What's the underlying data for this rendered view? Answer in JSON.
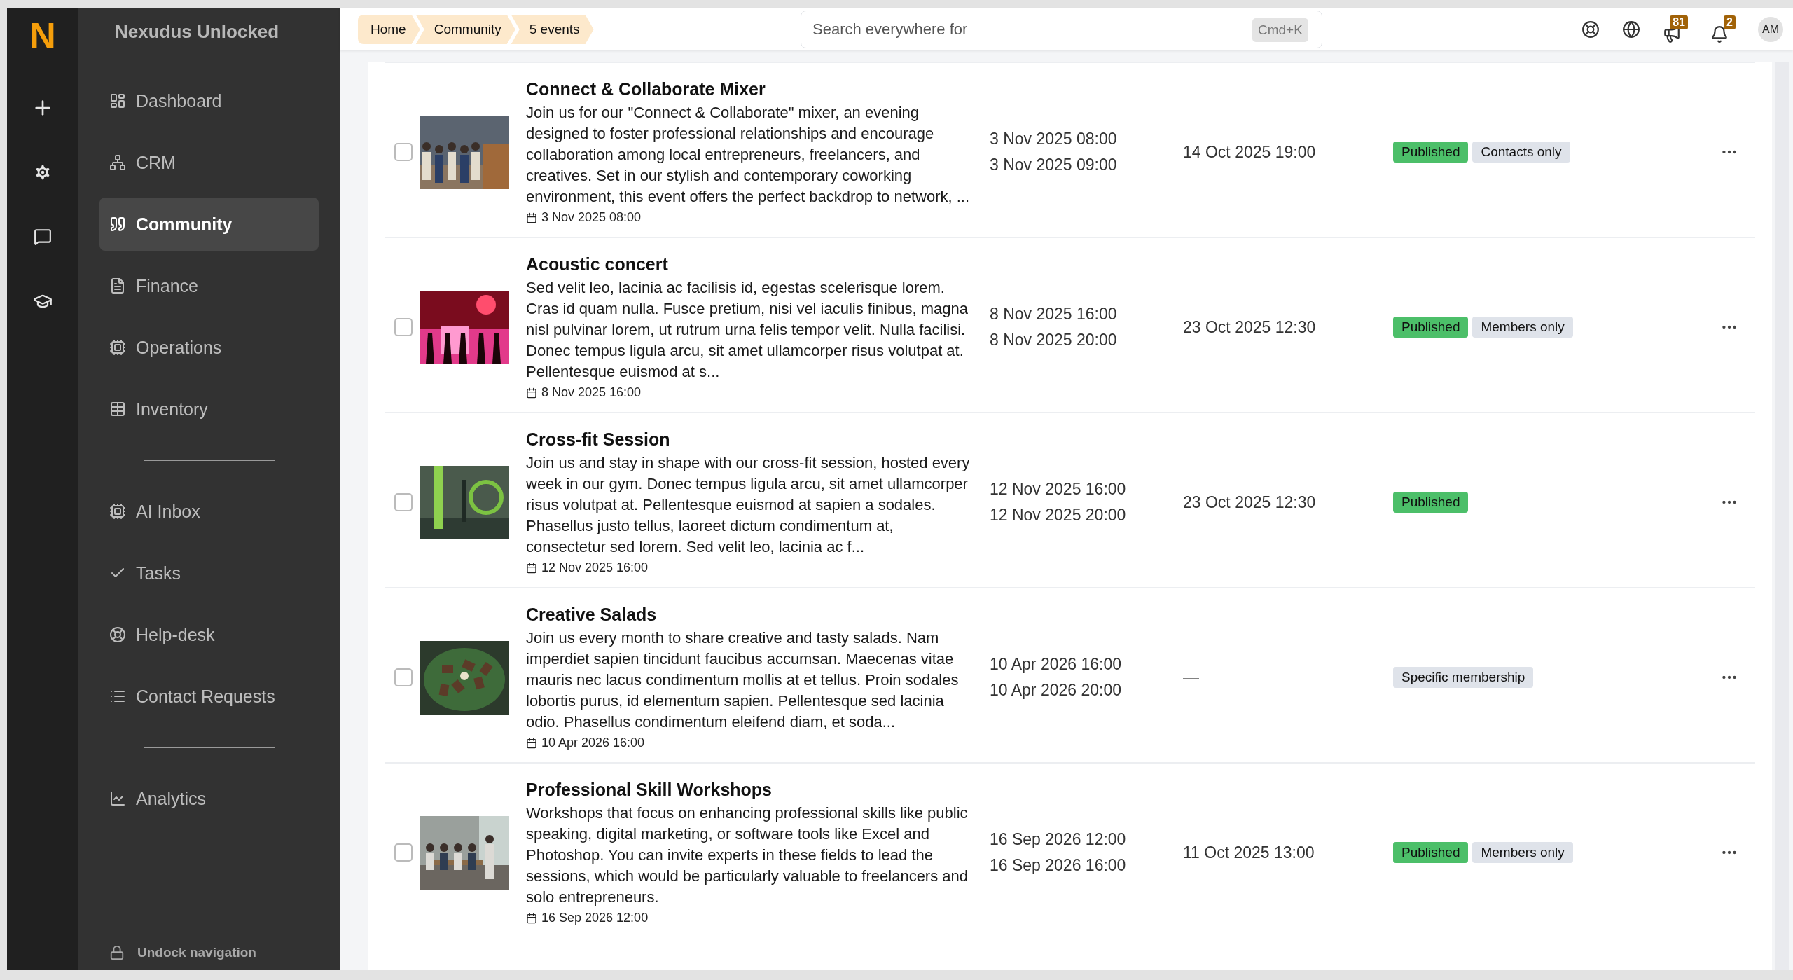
{
  "brand": {
    "logo": "N",
    "name": "Nexudus Unlocked"
  },
  "nav": {
    "sections": [
      {
        "items": [
          {
            "label": "Dashboard",
            "selected": false
          },
          {
            "label": "CRM",
            "selected": false
          },
          {
            "label": "Community",
            "selected": true
          },
          {
            "label": "Finance",
            "selected": false
          },
          {
            "label": "Operations",
            "selected": false
          },
          {
            "label": "Inventory",
            "selected": false
          }
        ]
      },
      {
        "items": [
          {
            "label": "AI Inbox",
            "selected": false
          },
          {
            "label": "Tasks",
            "selected": false
          },
          {
            "label": "Help-desk",
            "selected": false
          },
          {
            "label": "Contact Requests",
            "selected": false
          }
        ]
      },
      {
        "items": [
          {
            "label": "Analytics",
            "selected": false
          }
        ]
      }
    ],
    "footer": "Undock navigation"
  },
  "breadcrumbs": [
    "Home",
    "Community",
    "5 events"
  ],
  "search": {
    "placeholder": "Search everywhere for",
    "shortcut": "Cmd+K"
  },
  "topbar": {
    "announcements_count": "81",
    "notifications_count": "2",
    "avatar": "AM"
  },
  "events": [
    {
      "checked": false,
      "title": "Connect & Collaborate Mixer",
      "description": "Join us for our \"Connect & Collaborate\" mixer, an evening designed to foster professional relationships and encourage collaboration among local entrepreneurs, freelancers, and creatives. Set in our stylish and contemporary coworking environment, this event offers the perfect backdrop to network, ...",
      "date": "3 Nov 2025 08:00",
      "start": "3 Nov 2025 08:00",
      "end": "3 Nov 2025 09:00",
      "published_at": "14 Oct 2025 19:00",
      "tags": [
        {
          "kind": "status",
          "label": "Published"
        },
        {
          "kind": "audience",
          "label": "Contacts only"
        }
      ]
    },
    {
      "checked": false,
      "title": "Acoustic concert",
      "description": "Sed velit leo, lacinia ac facilisis id, egestas scelerisque lorem. Cras id quam nulla. Fusce pretium, nisi vel iaculis finibus, magna nisl pulvinar lorem, ut rutrum urna felis tempor velit. Nulla facilisi. Donec tempus ligula arcu, sit amet ullamcorper risus volutpat at. Pellentesque euismod at s...",
      "date": "8 Nov 2025 16:00",
      "start": "8 Nov 2025 16:00",
      "end": "8 Nov 2025 20:00",
      "published_at": "23 Oct 2025 12:30",
      "tags": [
        {
          "kind": "status",
          "label": "Published"
        },
        {
          "kind": "audience",
          "label": "Members only"
        }
      ]
    },
    {
      "checked": false,
      "title": "Cross-fit Session",
      "description": "Join us and stay in shape with our cross-fit session, hosted every week in our gym. Donec tempus ligula arcu, sit amet ullamcorper risus volutpat at. Pellentesque euismod at sapien a sodales. Phasellus justo tellus, laoreet dictum condimentum at, consectetur sed lorem. Sed velit leo, lacinia ac f...",
      "date": "12 Nov 2025 16:00",
      "start": "12 Nov 2025 16:00",
      "end": "12 Nov 2025 20:00",
      "published_at": "23 Oct 2025 12:30",
      "tags": [
        {
          "kind": "status",
          "label": "Published"
        }
      ]
    },
    {
      "checked": false,
      "title": "Creative Salads",
      "description": "Join us every month to share creative and tasty salads. Nam imperdiet sapien tincidunt faucibus accumsan. Maecenas vitae mauris nec lacus condimentum mollis at et tellus. Proin sodales lobortis purus, id elementum sapien. Pellentesque sed lacinia odio. Phasellus condimentum eleifend diam, et soda...",
      "date": "10 Apr 2026 16:00",
      "start": "10 Apr 2026 16:00",
      "end": "10 Apr 2026 20:00",
      "published_at": "—",
      "tags": [
        {
          "kind": "audience",
          "label": "Specific membership"
        }
      ]
    },
    {
      "checked": false,
      "title": "Professional Skill Workshops",
      "description": "Workshops that focus on enhancing professional skills like public speaking, digital marketing, or software tools like Excel and Photoshop. You can invite experts in these fields to lead the sessions, which would be particularly valuable to freelancers and solo entrepreneurs.",
      "date": "16 Sep 2026 12:00",
      "start": "16 Sep 2026 12:00",
      "end": "16 Sep 2026 16:00",
      "published_at": "11 Oct 2025 13:00",
      "tags": [
        {
          "kind": "status",
          "label": "Published"
        },
        {
          "kind": "audience",
          "label": "Members only"
        }
      ]
    }
  ]
}
